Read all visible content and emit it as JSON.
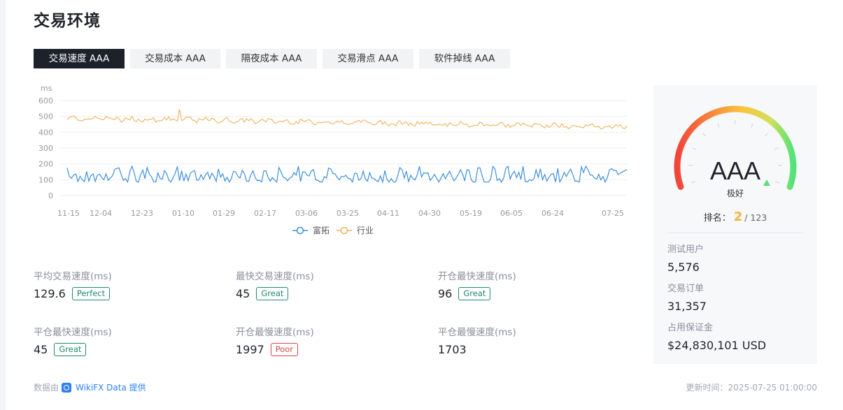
{
  "page": {
    "title": "交易环境"
  },
  "tabs": [
    {
      "label": "交易速度 AAA",
      "active": true
    },
    {
      "label": "交易成本 AAA",
      "active": false
    },
    {
      "label": "隔夜成本 AAA",
      "active": false
    },
    {
      "label": "交易滑点 AAA",
      "active": false
    },
    {
      "label": "软件掉线 AAA",
      "active": false
    }
  ],
  "chart_data": {
    "type": "line",
    "ylabel": "ms",
    "ylim": [
      0,
      600
    ],
    "yticks": [
      0,
      100,
      200,
      300,
      400,
      500,
      600
    ],
    "x_tick_labels": [
      "11-15",
      "12-04",
      "12-23",
      "01-10",
      "01-29",
      "02-17",
      "03-06",
      "03-25",
      "04-11",
      "04-30",
      "05-19",
      "06-05",
      "06-24",
      "07-25"
    ],
    "grid": true,
    "legend": "bottom-center",
    "series": [
      {
        "name": "富拓",
        "color": "#3b8fe0",
        "base": 130,
        "amplitude": 45,
        "end_value": 165
      },
      {
        "name": "行业",
        "color": "#f0b05a",
        "start_value": 490,
        "end_value": 435,
        "amplitude": 15
      }
    ]
  },
  "stats": [
    {
      "label": "平均交易速度(ms)",
      "value": "129.6",
      "badge": "Perfect",
      "badge_color": "green"
    },
    {
      "label": "最快交易速度(ms)",
      "value": "45",
      "badge": "Great",
      "badge_color": "green"
    },
    {
      "label": "开仓最快速度(ms)",
      "value": "96",
      "badge": "Great",
      "badge_color": "green"
    },
    {
      "label": "平仓最快速度(ms)",
      "value": "45",
      "badge": "Great",
      "badge_color": "green"
    },
    {
      "label": "开仓最慢速度(ms)",
      "value": "1997",
      "badge": "Poor",
      "badge_color": "red"
    },
    {
      "label": "平仓最慢速度(ms)",
      "value": "1703",
      "badge": "",
      "badge_color": ""
    }
  ],
  "panel": {
    "grade": "AAA",
    "grade_text": "极好",
    "rank_label": "排名：",
    "rank_value": "2",
    "rank_total": "/ 123",
    "test_users_label": "测试用户",
    "test_users_value": "5,576",
    "orders_label": "交易订单",
    "orders_value": "31,357",
    "margin_label": "占用保证金",
    "margin_value": "$24,830,101 USD"
  },
  "footer": {
    "source_prefix": "数据由",
    "source_name": "WikiFX Data 提供",
    "updated": "更新时间：2025-07-25 01:00:00"
  },
  "colors": {
    "accent_dark": "#1d2129",
    "badge_green": "#1e8b6a",
    "badge_red": "#d64545",
    "rank_yellow": "#f5b43c"
  }
}
